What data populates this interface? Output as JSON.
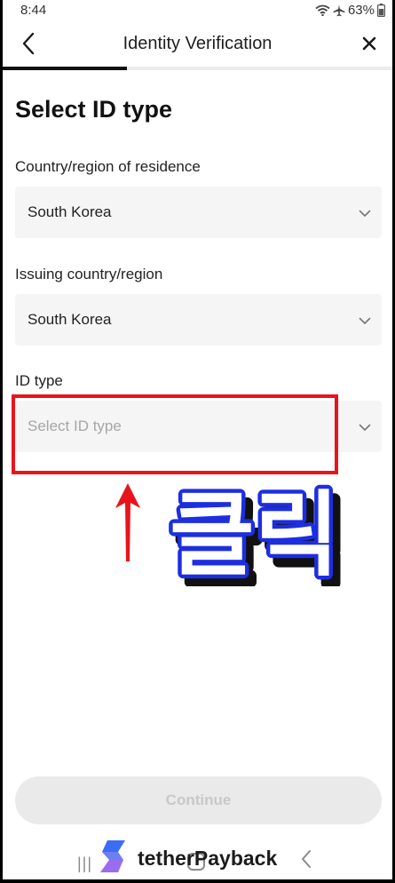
{
  "status_bar": {
    "time": "8:44",
    "battery": "63%",
    "icons": [
      "wifi-icon",
      "airplane-icon",
      "battery-icon"
    ]
  },
  "header": {
    "title": "Identity Verification",
    "back_icon": "chevron-left-icon",
    "close_icon": "close-icon",
    "progress": 0.32
  },
  "page": {
    "title": "Select ID type"
  },
  "fields": {
    "residence": {
      "label": "Country/region of residence",
      "value": "South Korea"
    },
    "issuing": {
      "label": "Issuing country/region",
      "value": "South Korea"
    },
    "id_type": {
      "label": "ID type",
      "placeholder": "Select ID type"
    }
  },
  "annotation": {
    "text": "클릭",
    "highlight_color": "#e8141c",
    "text_color": "#1d2ee0"
  },
  "continue_button": {
    "label": "Continue"
  },
  "watermark": {
    "text": "tetherPayback",
    "logo_colors": [
      "#3b6df5",
      "#9a6cf0"
    ]
  },
  "colors": {
    "accent": "#111111",
    "field_bg": "#f5f5f6",
    "disabled_button_bg": "#eaeaea",
    "disabled_button_text": "#c8c8c8"
  }
}
